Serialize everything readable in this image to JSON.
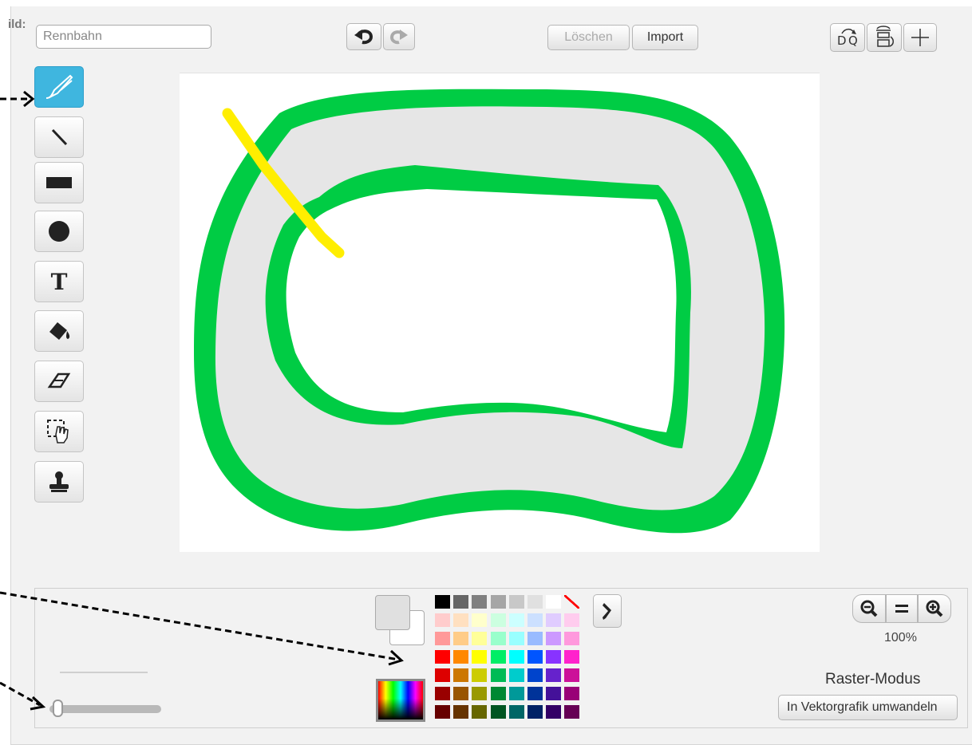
{
  "costume": {
    "label": "ild:",
    "name_value": "Rennbahn"
  },
  "toolbar": {
    "undo_icon": "undo-icon",
    "redo_icon": "redo-icon",
    "clear_label": "Löschen",
    "import_label": "Import",
    "flip_horizontal_icon": "flip-horizontal-icon",
    "flip_vertical_icon": "flip-vertical-icon",
    "set_center_icon": "crosshair-icon"
  },
  "tools": [
    {
      "name": "brush",
      "icon": "brush-icon",
      "active": true
    },
    {
      "name": "line",
      "icon": "line-icon",
      "active": false
    },
    {
      "name": "rectangle",
      "icon": "rectangle-icon",
      "active": false
    },
    {
      "name": "ellipse",
      "icon": "ellipse-icon",
      "active": false
    },
    {
      "name": "text",
      "icon": "text-icon",
      "active": false,
      "glyph": "T"
    },
    {
      "name": "fill",
      "icon": "paint-bucket-icon",
      "active": false
    },
    {
      "name": "eraser",
      "icon": "eraser-icon",
      "active": false
    },
    {
      "name": "select",
      "icon": "select-hand-icon",
      "active": false
    },
    {
      "name": "stamp",
      "icon": "stamp-icon",
      "active": false
    }
  ],
  "canvas": {
    "track_color": "#00cc44",
    "road_color": "#e6e6e6",
    "line_color": "#ffee00"
  },
  "palette": {
    "rows": [
      [
        "#000000",
        "#666666",
        "#808080",
        "#a6a6a6",
        "#c8c8c8",
        "#e0e0e0",
        "#ffffff",
        "none"
      ],
      [
        "#ffcccc",
        "#ffe0c0",
        "#ffffcc",
        "#ccffe0",
        "#ccffff",
        "#cce0ff",
        "#e0ccff",
        "#ffccee"
      ],
      [
        "#ff9999",
        "#ffcc88",
        "#ffff99",
        "#99ffcc",
        "#99ffff",
        "#99bbff",
        "#cc99ff",
        "#ff99dd"
      ],
      [
        "#ff0000",
        "#ff8800",
        "#ffff00",
        "#00ee66",
        "#00ffff",
        "#0055ff",
        "#8833ff",
        "#ff22cc"
      ],
      [
        "#dd0000",
        "#cc7700",
        "#cccc00",
        "#00bb55",
        "#00cccc",
        "#0044cc",
        "#6622cc",
        "#cc1199"
      ],
      [
        "#990000",
        "#995500",
        "#999900",
        "#008833",
        "#009999",
        "#003399",
        "#441199",
        "#990077"
      ],
      [
        "#660000",
        "#663300",
        "#666600",
        "#005522",
        "#006666",
        "#002266",
        "#330066",
        "#660055"
      ]
    ],
    "primary_color": "#e0e0e0",
    "secondary_color": "#ffffff",
    "eyedropper_icon": "eyedropper-icon",
    "color_picker_icon": "color-spectrum-icon"
  },
  "zoom": {
    "zoom_out_icon": "zoom-out-icon",
    "reset_icon": "zoom-reset-icon",
    "zoom_in_icon": "zoom-in-icon",
    "level": "100%"
  },
  "mode": {
    "label": "Raster-Modus",
    "convert_label": "In Vektorgrafik umwandeln"
  },
  "brush_size": {
    "level": 0.05
  }
}
